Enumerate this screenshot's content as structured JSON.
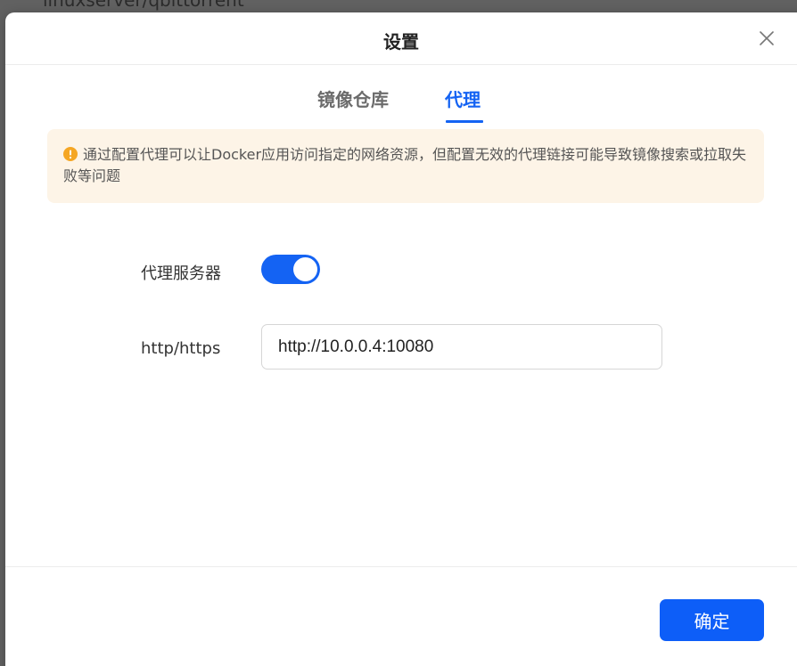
{
  "background": {
    "text": "linuxserver/qbittorrent"
  },
  "dialog": {
    "title": "设置",
    "close_icon": "close-icon"
  },
  "tabs": [
    {
      "label": "镜像仓库",
      "active": false
    },
    {
      "label": "代理",
      "active": true
    }
  ],
  "alert": {
    "icon": "warning-icon",
    "text": "通过配置代理可以让Docker应用访问指定的网络资源，但配置无效的代理链接可能导致镜像搜索或拉取失败等问题"
  },
  "form": {
    "proxy_server_label": "代理服务器",
    "proxy_enabled": true,
    "http_label": "http/https",
    "http_value": "http://10.0.0.4:10080"
  },
  "footer": {
    "confirm_label": "确定"
  },
  "colors": {
    "accent": "#1463f3",
    "button": "#0d5ef8",
    "alert_bg": "#fdf4e7",
    "warning": "#f5a623"
  }
}
